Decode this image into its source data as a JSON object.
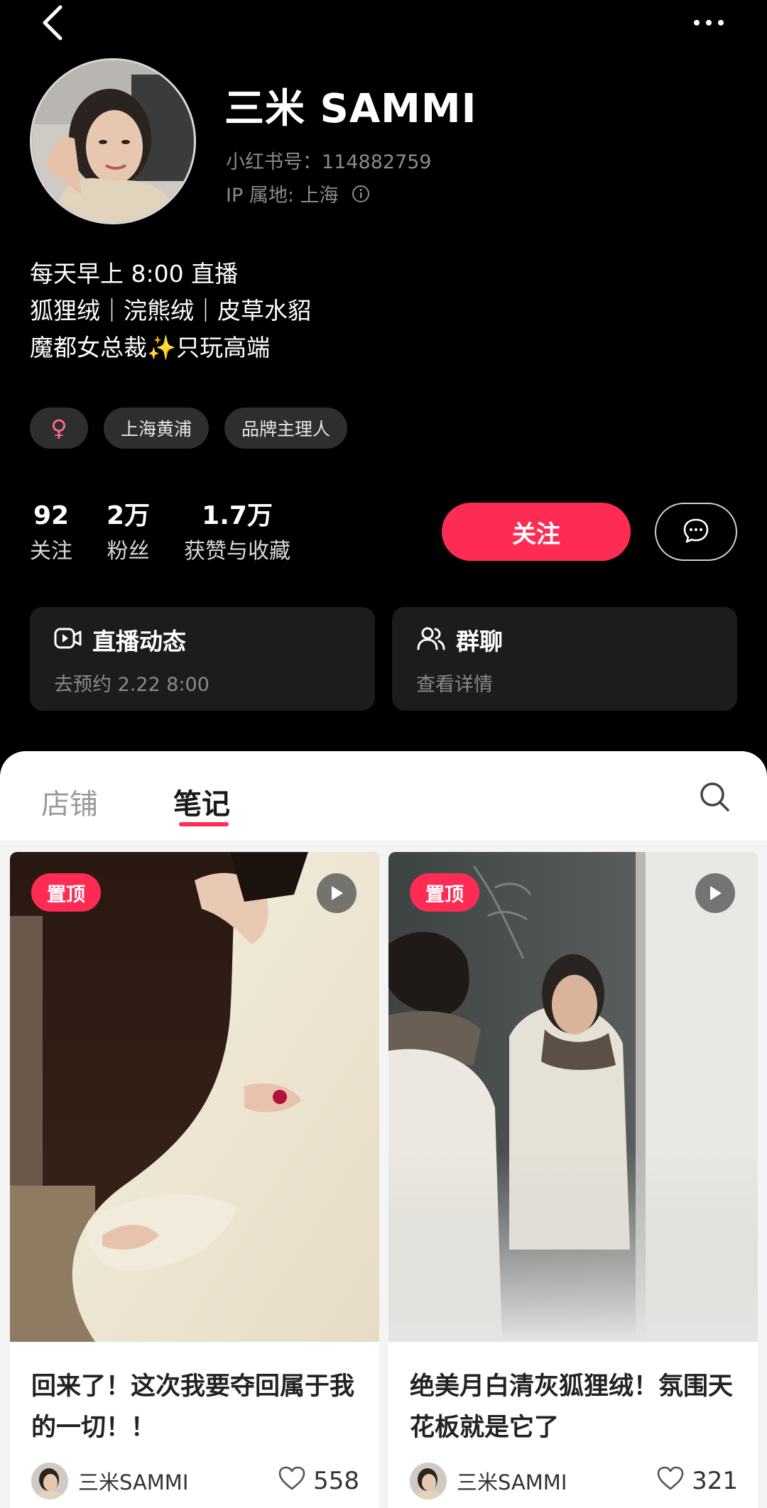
{
  "profile": {
    "nickname": "三米 SAMMI",
    "red_id": "小红书号：114882759",
    "ip_location": "IP 属地: 上海",
    "bio_lines": [
      "每天早上 8:00 直播",
      "狐狸绒｜浣熊绒｜皮草水貂",
      "魔都女总裁✨只玩高端"
    ],
    "tags": {
      "gender_symbol": "♀",
      "location": "上海黄浦",
      "role": "品牌主理人"
    }
  },
  "stats": [
    {
      "value": "92",
      "label": "关注"
    },
    {
      "value": "2万",
      "label": "粉丝"
    },
    {
      "value": "1.7万",
      "label": "获赞与收藏"
    }
  ],
  "actions": {
    "follow_label": "关注"
  },
  "cards": {
    "live": {
      "title": "直播动态",
      "subtitle": "去预约 2.22 8:00"
    },
    "group": {
      "title": "群聊",
      "subtitle": "查看详情"
    }
  },
  "tabs": {
    "store": "店铺",
    "notes": "笔记"
  },
  "notes": [
    {
      "badge": "置顶",
      "title": "回来了！这次我要夺回属于我的一切！！",
      "author": "三米SAMMI",
      "likes": "558"
    },
    {
      "badge": "置顶",
      "title": "绝美月白清灰狐狸绒！氛围天花板就是它了",
      "author": "三米SAMMI",
      "likes": "321"
    }
  ],
  "colors": {
    "accent": "#fe2c55",
    "header_bg": "#000000",
    "card_bg": "#1c1c1c",
    "sheet_bg": "#ffffff"
  },
  "icons": [
    "back-arrow-icon",
    "more-dots-icon",
    "info-icon",
    "female-icon",
    "message-icon",
    "live-video-icon",
    "group-users-icon",
    "search-icon",
    "play-icon",
    "heart-icon"
  ]
}
